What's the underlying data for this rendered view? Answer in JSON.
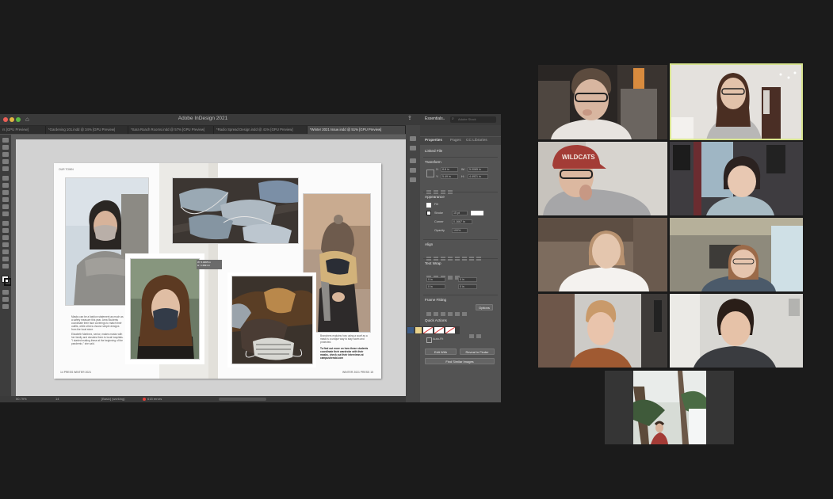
{
  "indesign": {
    "app_title": "Adobe InDesign 2021",
    "doc_tabs": [
      {
        "label": "rs [GPU Preview]",
        "active": false
      },
      {
        "label": "*Gardening 101.indd @ 34% [GPU Preview]",
        "active": false
      },
      {
        "label": "*Sara Roach Rooms.indd @ 57% [GPU Preview]",
        "active": false
      },
      {
        "label": "*Radio Spread Design.indd @ 41% [GPU Preview]",
        "active": false
      },
      {
        "label": "*Winter 2021 Issue.indd @ 51% [GPU Preview]",
        "active": true
      }
    ],
    "workspace": {
      "label": "Essentials",
      "search_placeholder": "Adobe Stock"
    },
    "panel_tabs": [
      "Properties",
      "Pages",
      "CC Libraries"
    ],
    "panel": {
      "linked_file": "Linked File",
      "transform": "Transform",
      "x": "8.8 in",
      "y": "5.49 in",
      "w": "5.0065 in",
      "h": "4.4921 in",
      "appearance": "Appearance",
      "fill": "Fill",
      "stroke": "Stroke",
      "stroke_value": "15 pt",
      "corner": "Corner",
      "corner_value": "0.1667 in",
      "opacity": "Opacity",
      "opacity_value": "100%",
      "align": "Align",
      "text_wrap": "Text Wrap",
      "wrap_value": "0 in",
      "frame_fitting": "Frame Fitting",
      "options": "Options",
      "quick_actions": "Quick Actions",
      "auto_fit": "Auto-Fit",
      "edit_with": "Edit With",
      "reveal_in_finder": "Reveal in Finder",
      "find_similar": "Find Similar Images"
    },
    "layout": {
      "header_left": "OUR TOWN",
      "folio_left": "14 PRESS WINTER 2021",
      "folio_right": "WINTER 2021 PRESS 15",
      "body_left": "Masks can be a fashion statement as much as a safety measure this year. Area Students coordinate their face coverings to match their outfits, while others choose simple designs from the local store.",
      "body_left2": "Elizabeth Martinez, senior, makes masks with her family and donates them to local hospitals. \"I started making these at the beginning of the pandemic,\" she said.",
      "body_right": "Branchers explains how using a scarf as a mask is a unique way to stay warm and protected.",
      "body_right_bold": "To find out more on how these students coordinate their wardrobe with their masks, check out their interviews at campusherald.com",
      "measure_label": "W: 5.0065 in\nH: 4.4921 in"
    },
    "status": {
      "zoom": "50.79%",
      "page": "14",
      "style": "[Basic] (working)",
      "errors": "615 errors"
    }
  },
  "zoom": {
    "participants": [
      {
        "id": "p1",
        "speaking": false
      },
      {
        "id": "p2",
        "speaking": true
      },
      {
        "id": "p3",
        "speaking": false,
        "hat_text": "WILDCATS"
      },
      {
        "id": "p4",
        "speaking": false
      },
      {
        "id": "p5",
        "speaking": false
      },
      {
        "id": "p6",
        "speaking": false
      },
      {
        "id": "p7",
        "speaking": false
      },
      {
        "id": "p8",
        "speaking": false
      },
      {
        "id": "p9",
        "speaking": false
      }
    ],
    "accent_color": "#d7e38f"
  }
}
